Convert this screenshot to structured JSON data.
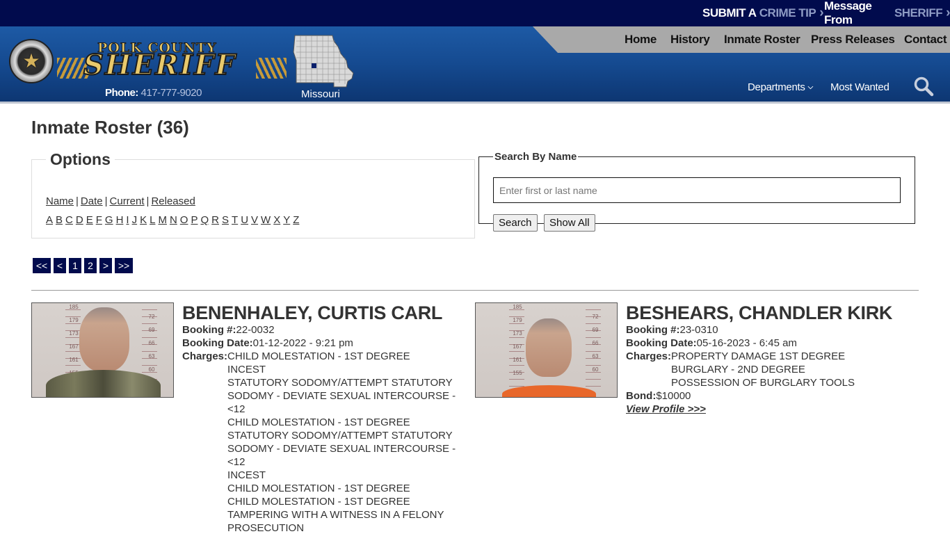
{
  "topbar": {
    "tip_prefix": "SUBMIT A",
    "tip_highlight": "CRIME TIP",
    "message_prefix": "Message From",
    "message_highlight": "SHERIFF"
  },
  "logo": {
    "county": "POLK COUNTY",
    "title": "SHERIFF",
    "phone_label": "Phone:",
    "phone_number": "417-777-9020",
    "state_label": "Missouri"
  },
  "nav": {
    "home": "Home",
    "history": "History",
    "inmate_roster": "Inmate Roster",
    "press_releases": "Press Releases",
    "contact": "Contact",
    "departments": "Departments",
    "most_wanted": "Most Wanted"
  },
  "page_title": "Inmate Roster (36)",
  "options": {
    "legend": "Options",
    "sort_links": [
      "Name",
      "Date",
      "Current",
      "Released"
    ],
    "letters": [
      "A",
      "B",
      "C",
      "D",
      "E",
      "F",
      "G",
      "H",
      "I",
      "J",
      "K",
      "L",
      "M",
      "N",
      "O",
      "P",
      "Q",
      "R",
      "S",
      "T",
      "U",
      "V",
      "W",
      "X",
      "Y",
      "Z"
    ]
  },
  "search": {
    "legend": "Search By Name",
    "placeholder": "Enter first or last name",
    "search_button": "Search",
    "show_all_button": "Show All"
  },
  "pager": [
    "<<",
    "<",
    "1",
    "2",
    ">",
    ">>"
  ],
  "inmates": [
    {
      "name": "BENENHALEY, CURTIS CARL",
      "booking_number_label": "Booking #:",
      "booking_number": "22-0032",
      "booking_date_label": "Booking Date:",
      "booking_date": "01-12-2022 - 9:21 pm",
      "charges_label": "Charges:",
      "charges": [
        "CHILD MOLESTATION - 1ST DEGREE",
        "INCEST",
        "STATUTORY SODOMY/ATTEMPT STATUTORY SODOMY - DEVIATE SEXUAL INTERCOURSE - <12",
        "CHILD MOLESTATION - 1ST DEGREE",
        "STATUTORY SODOMY/ATTEMPT STATUTORY SODOMY - DEVIATE SEXUAL INTERCOURSE - <12",
        "INCEST",
        "CHILD MOLESTATION - 1ST DEGREE",
        "CHILD MOLESTATION - 1ST DEGREE",
        "TAMPERING WITH A WITNESS IN A FELONY PROSECUTION"
      ],
      "mugshot_ruler_left": [
        "185",
        "179",
        "173",
        "167",
        "161",
        "155"
      ],
      "mugshot_ruler_right": [
        "72",
        "69",
        "66",
        "63",
        "60"
      ]
    },
    {
      "name": "BESHEARS, CHANDLER KIRK",
      "booking_number_label": "Booking #:",
      "booking_number": "23-0310",
      "booking_date_label": "Booking Date:",
      "booking_date": "05-16-2023 - 6:45 am",
      "charges_label": "Charges:",
      "charges": [
        "PROPERTY DAMAGE 1ST DEGREE",
        "BURGLARY - 2ND DEGREE",
        "POSSESSION OF BURGLARY TOOLS"
      ],
      "bond_label": "Bond:",
      "bond": "$10000",
      "view_profile": "View Profile >>>",
      "mugshot_ruler_left": [
        "185",
        "179",
        "173",
        "167",
        "161",
        "155"
      ],
      "mugshot_ruler_right": [
        "72",
        "69",
        "66",
        "63",
        "60"
      ]
    }
  ],
  "colors": {
    "topbar": "#010b4d",
    "header_blue": "#1d5aa5",
    "nav_gray": "#a9a9a9",
    "accent_light": "#8e9bc4",
    "logo_gold": "#e8c96c"
  }
}
